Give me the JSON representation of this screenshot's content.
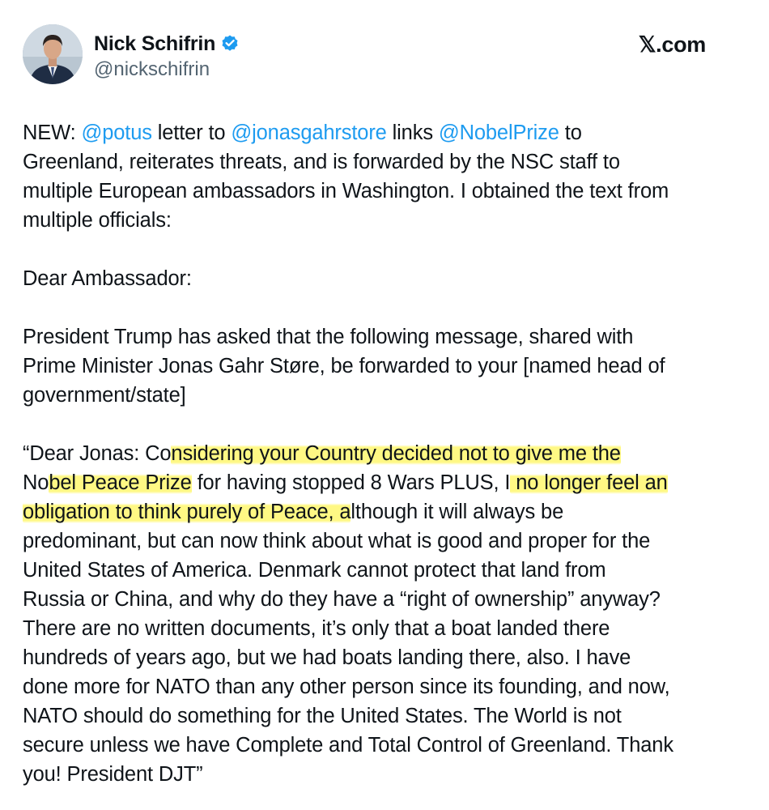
{
  "author": {
    "display_name": "Nick Schifrin",
    "handle": "@nickschifrin",
    "verified": true,
    "verified_color": "#1d9bf0"
  },
  "source_label": "𝕏.com",
  "colors": {
    "link": "#1d9bf0",
    "text": "#0f1419",
    "muted": "#536471",
    "highlight": "#fff76e"
  },
  "intro": {
    "l1_pre": "NEW: ",
    "l1_m1": "@potus",
    "l1_mid1": " letter to ",
    "l1_m2": "@jonasgahrstore",
    "l1_mid2": " links ",
    "l1_m3": "@NobelPrize",
    "l1_post": " to",
    "l2": "Greenland, reiterates threats, and is forwarded by the NSC staff to",
    "l3": "multiple European ambassadors in Washington. I obtained the text from",
    "l4": "multiple officials:"
  },
  "salutation": "Dear Ambassador:",
  "request": {
    "l1": "President Trump has asked that the following message, shared with",
    "l2": "Prime Minister Jonas Gahr Støre, be forwarded to your [named head of",
    "l3": "government/state]"
  },
  "letter": {
    "l1_a": "“Dear Jonas: Co",
    "l1_hl": "nsidering your Country decided not to give me the",
    "l2_a": "No",
    "l2_hl1": "bel Peace Prize",
    "l2_b": " for having stopped 8 Wars PLUS, I",
    "l2_hl2": " no longer feel an",
    "l3_hl": "obligation to think purely of Peace, a",
    "l3_b": "lthough it will always be",
    "l4": "predominant, but can now think about what is good and proper for the",
    "l5": "United States of America. Denmark cannot protect that land from",
    "l6": "Russia or China, and why do they have a “right of ownership” anyway?",
    "l7": "There are no written documents, it’s only that a boat landed there",
    "l8": "hundreds of years ago, but we had boats landing there, also. I have",
    "l9": "done more for NATO than any other person since its founding, and now,",
    "l10": "NATO should do something for the United States. The World is not",
    "l11": "secure unless we have Complete and Total Control of Greenland. Thank",
    "l12": "you! President DJT”"
  }
}
